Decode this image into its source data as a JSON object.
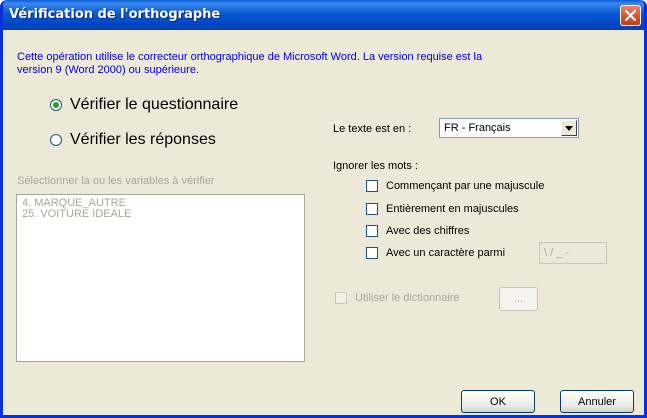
{
  "window": {
    "title": "Vérification de l'orthographe",
    "close_icon": "close-icon"
  },
  "info_text": "Cette opération utilise le correcteur orthographique de Microsoft Word. La version requise est la version 9 (Word 2000) ou supérieure.",
  "mode": {
    "options": [
      {
        "label": "Vérifier le questionnaire",
        "checked": true
      },
      {
        "label": "Vérifier les réponses",
        "checked": false
      }
    ]
  },
  "variables": {
    "label": "Sélectionner la ou les variables à vérifier",
    "items": [
      "4. MARQUE_AUTRE",
      "25. VOITURE IDEALE"
    ]
  },
  "language": {
    "label": "Le texte est en :",
    "value": "FR - Français"
  },
  "ignore": {
    "label": "Ignorer les mots :",
    "options": [
      {
        "label": "Commençant par une majuscule",
        "checked": false
      },
      {
        "label": "Entièrement en majuscules",
        "checked": false
      },
      {
        "label": "Avec des chiffres",
        "checked": false
      },
      {
        "label": "Avec un caractère parmi",
        "checked": false
      }
    ],
    "chars_value": "\\ / _ -"
  },
  "dictionary": {
    "label": "Utiliser le dictionnaire",
    "browse_label": "...",
    "checked": false
  },
  "buttons": {
    "ok": "OK",
    "cancel": "Annuler"
  }
}
